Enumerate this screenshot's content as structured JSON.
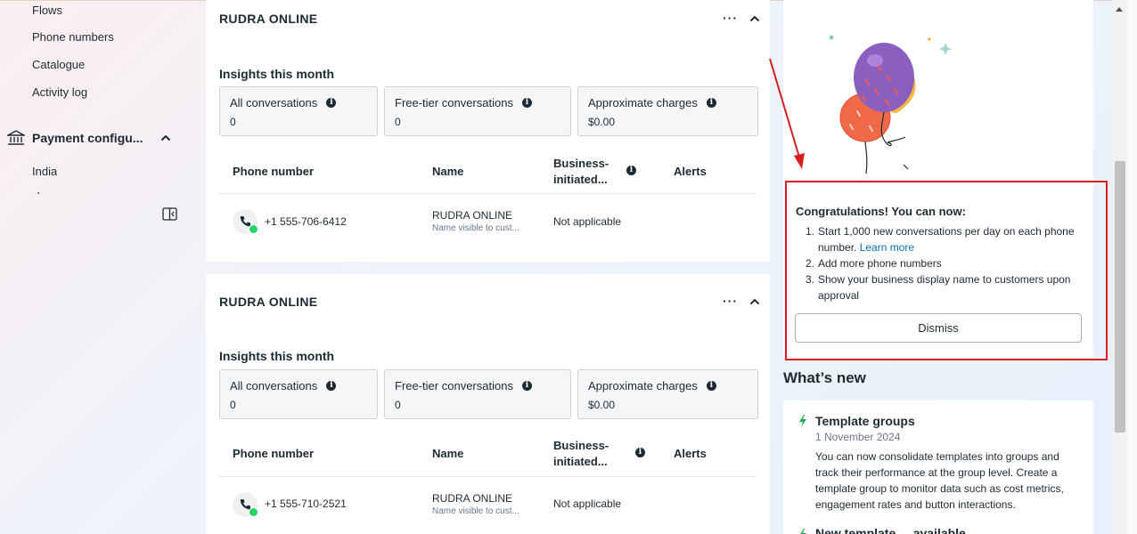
{
  "sidebar": {
    "items": [
      {
        "label": "Flows"
      },
      {
        "label": "Phone numbers"
      },
      {
        "label": "Catalogue"
      },
      {
        "label": "Activity log"
      }
    ],
    "payment": {
      "label": "Payment configu...",
      "sub_items": [
        {
          "label": "India"
        }
      ]
    }
  },
  "accounts": [
    {
      "name": "RUDRA ONLINE",
      "more": "···",
      "insights_title": "Insights this month",
      "metrics": [
        {
          "label": "All conversations",
          "value": "0"
        },
        {
          "label": "Free-tier conversations",
          "value": "0"
        },
        {
          "label": "Approximate charges",
          "value": "$0.00"
        }
      ],
      "columns": {
        "phone": "Phone number",
        "name": "Name",
        "business_1": "Business-",
        "business_2": "initiated...",
        "alerts": "Alerts"
      },
      "row": {
        "phone": "+1 555-706-6412",
        "name": "RUDRA ONLINE",
        "name_sub": "Name visible to cust...",
        "business": "Not applicable"
      }
    },
    {
      "name": "RUDRA ONLINE",
      "more": "···",
      "insights_title": "Insights this month",
      "metrics": [
        {
          "label": "All conversations",
          "value": "0"
        },
        {
          "label": "Free-tier conversations",
          "value": "0"
        },
        {
          "label": "Approximate charges",
          "value": "$0.00"
        }
      ],
      "columns": {
        "phone": "Phone number",
        "name": "Name",
        "business_1": "Business-",
        "business_2": "initiated...",
        "alerts": "Alerts"
      },
      "row": {
        "phone": "+1 555-710-2521",
        "name": "RUDRA ONLINE",
        "name_sub": "Name visible to cust...",
        "business": "Not applicable"
      }
    }
  ],
  "congrats": {
    "title": "Congratulations! You can now:",
    "items": [
      {
        "num": "1.",
        "text": "Start 1,000 new conversations per day on each phone number.",
        "link": "Learn more"
      },
      {
        "num": "2.",
        "text": "Add more phone numbers"
      },
      {
        "num": "3.",
        "text": "Show your business display name to customers upon approval"
      }
    ],
    "dismiss": "Dismiss"
  },
  "whats_new": {
    "title": "What’s new",
    "news": [
      {
        "title": "Template groups",
        "date": "1 November 2024",
        "body": "You can now consolidate templates into groups and track their performance at the group level. Create a template group to monitor data such as cost metrics, engagement rates and button interactions."
      },
      {
        "title": "New template ... available"
      }
    ]
  },
  "colors": {
    "highlight": "#d81e1e",
    "link": "#0a6fc2",
    "whatsapp": "#25d366",
    "news_bolt": "#1fae5b"
  }
}
